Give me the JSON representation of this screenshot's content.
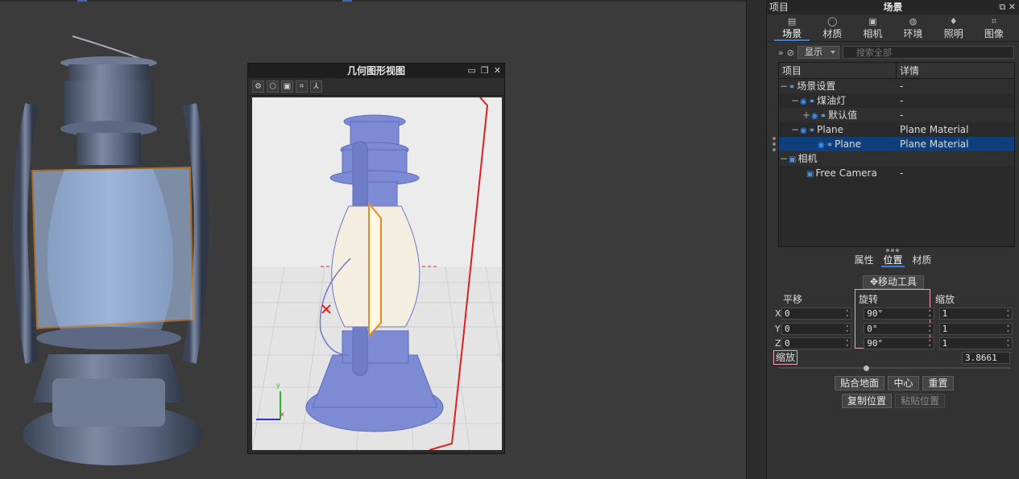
{
  "geometry_window": {
    "title": "几何图形视图",
    "controls": [
      "▭",
      "❐",
      "✕"
    ],
    "toolbar_icons": [
      "gear-icon",
      "cube-icon",
      "camera-icon",
      "grid-icon",
      "axes-icon"
    ]
  },
  "panel": {
    "header_left": "项目",
    "header_title": "场景",
    "header_controls": "⧉ ✕",
    "tabs": [
      {
        "label": "场景",
        "icon": "▤"
      },
      {
        "label": "材质",
        "icon": "◯"
      },
      {
        "label": "相机",
        "icon": "▣"
      },
      {
        "label": "环境",
        "icon": "◍"
      },
      {
        "label": "照明",
        "icon": "♦"
      },
      {
        "label": "图像",
        "icon": "⌗"
      }
    ],
    "filter": {
      "show_label": "显示",
      "search_placeholder": "搜索全部"
    },
    "tree": {
      "col_item": "项目",
      "col_detail": "详情",
      "rows": [
        {
          "toggle": "−",
          "indent": 0,
          "label": "场景设置",
          "detail": "-"
        },
        {
          "toggle": "−",
          "indent": 1,
          "label": "煤油灯",
          "detail": "-"
        },
        {
          "toggle": "+",
          "indent": 2,
          "label": "默认值",
          "detail": "-"
        },
        {
          "toggle": "−",
          "indent": 1,
          "label": "Plane",
          "detail": "Plane Material"
        },
        {
          "toggle": "",
          "indent": 2,
          "label": "Plane",
          "detail": "Plane Material"
        },
        {
          "toggle": "−",
          "indent": 0,
          "label": "相机",
          "detail": ""
        },
        {
          "toggle": "",
          "indent": 1,
          "label": "Free Camera",
          "detail": "-"
        }
      ]
    },
    "subtabs": [
      "属性",
      "位置",
      "材质"
    ],
    "move_tool": "移动工具",
    "transform": {
      "translate_label": "平移",
      "rotate_label": "旋转",
      "scale_label": "缩放",
      "axes": [
        "X",
        "Y",
        "Z"
      ],
      "translate": [
        "0",
        "0",
        "0"
      ],
      "rotate": [
        "90°",
        "0°",
        "90°"
      ],
      "scale": [
        "1",
        "1",
        "1"
      ]
    },
    "uniform_scale_label": "缩放",
    "uniform_scale_value": "3.8661",
    "uniform_scale_slider": 0.38,
    "buttons": {
      "snap_ground": "贴合地面",
      "center": "中心",
      "reset": "重置",
      "copy_position": "复制位置",
      "paste_position": "粘贴位置"
    }
  }
}
